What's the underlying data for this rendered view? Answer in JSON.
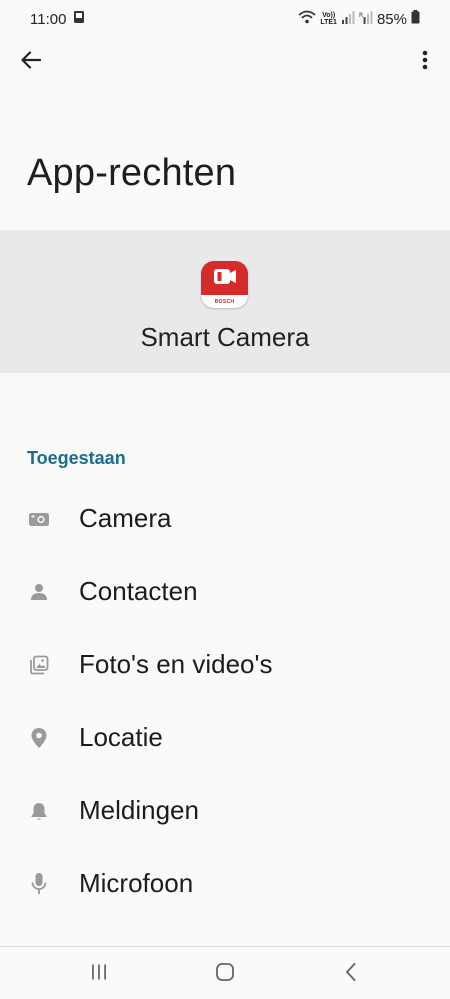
{
  "status_bar": {
    "time": "11:00",
    "network_label_top": "Vo))",
    "network_label_bottom": "LTE1",
    "battery": "85%"
  },
  "toolbar": {
    "back_icon": "arrow-left-icon",
    "more_icon": "more-vertical-icon"
  },
  "page": {
    "title": "App-rechten"
  },
  "app": {
    "name": "Smart Camera",
    "icon_text": "BOSCH",
    "icon_color": "#d52b2b"
  },
  "permissions": {
    "section_title": "Toegestaan",
    "items": [
      {
        "label": "Camera",
        "icon": "camera-icon"
      },
      {
        "label": "Contacten",
        "icon": "person-icon"
      },
      {
        "label": "Foto's en video's",
        "icon": "photos-icon"
      },
      {
        "label": "Locatie",
        "icon": "location-pin-icon"
      },
      {
        "label": "Meldingen",
        "icon": "bell-icon"
      },
      {
        "label": "Microfoon",
        "icon": "microphone-icon"
      }
    ]
  },
  "nav_bar": {
    "recents_icon": "recents-icon",
    "home_icon": "home-icon",
    "back_icon": "back-chevron-icon"
  },
  "colors": {
    "accent": "#1b6d8e",
    "card_background": "#e9e9ea",
    "icon_gray": "#9a9a9a"
  }
}
